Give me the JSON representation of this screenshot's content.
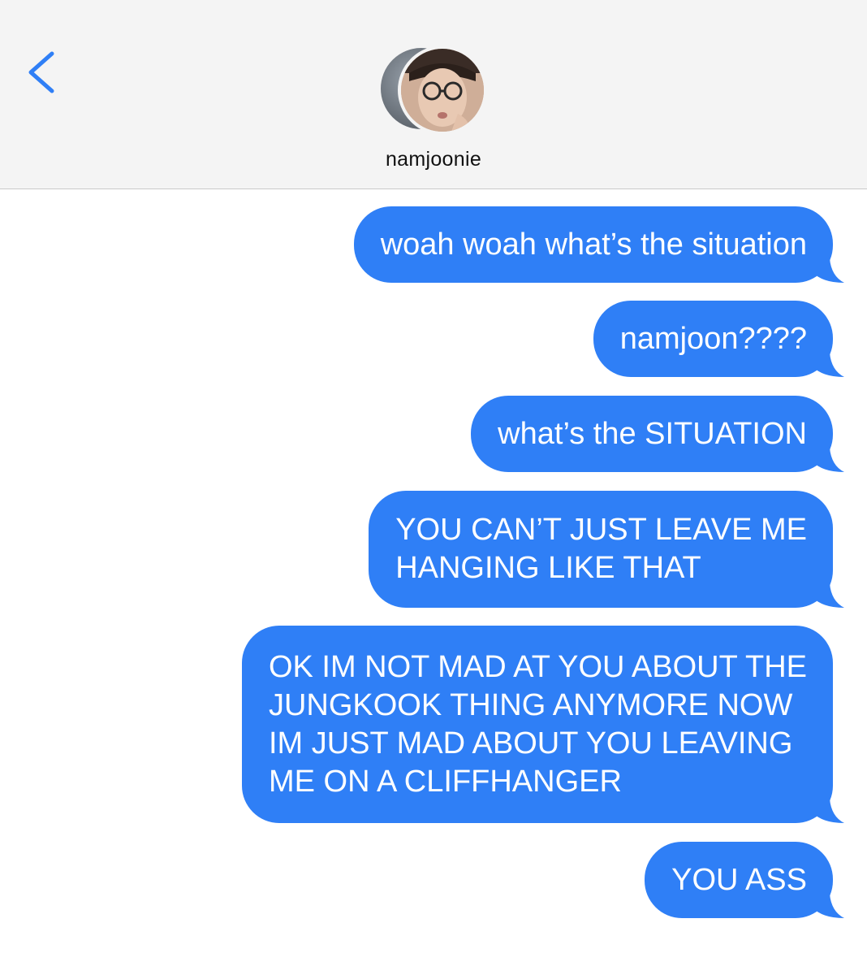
{
  "header": {
    "back_icon": "chevron-left-icon",
    "contact_name": "namjoonie",
    "accent_color": "#2f7ff6"
  },
  "messages": [
    {
      "text": "woah woah what’s the situation"
    },
    {
      "text": "namjoon????"
    },
    {
      "text": "what’s the SITUATION"
    },
    {
      "text": "YOU CAN’T JUST LEAVE ME\nHANGING LIKE THAT"
    },
    {
      "text": "OK IM NOT MAD AT YOU ABOUT THE\nJUNGKOOK THING ANYMORE NOW\nIM JUST MAD ABOUT YOU LEAVING\nME ON A CLIFFHANGER"
    },
    {
      "text": "YOU ASS"
    }
  ],
  "bubble_color": "#2f7ff6"
}
